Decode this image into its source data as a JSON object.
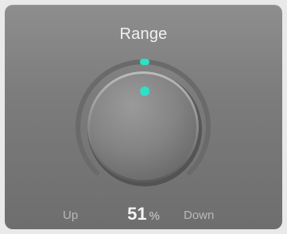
{
  "panel": {
    "title": "Range",
    "left_label": "Up",
    "right_label": "Down",
    "value": "51",
    "unit": "%"
  },
  "knob": {
    "level_percent": 51,
    "accent_color": "#2ee0c6",
    "indicator": "accent-dot"
  }
}
